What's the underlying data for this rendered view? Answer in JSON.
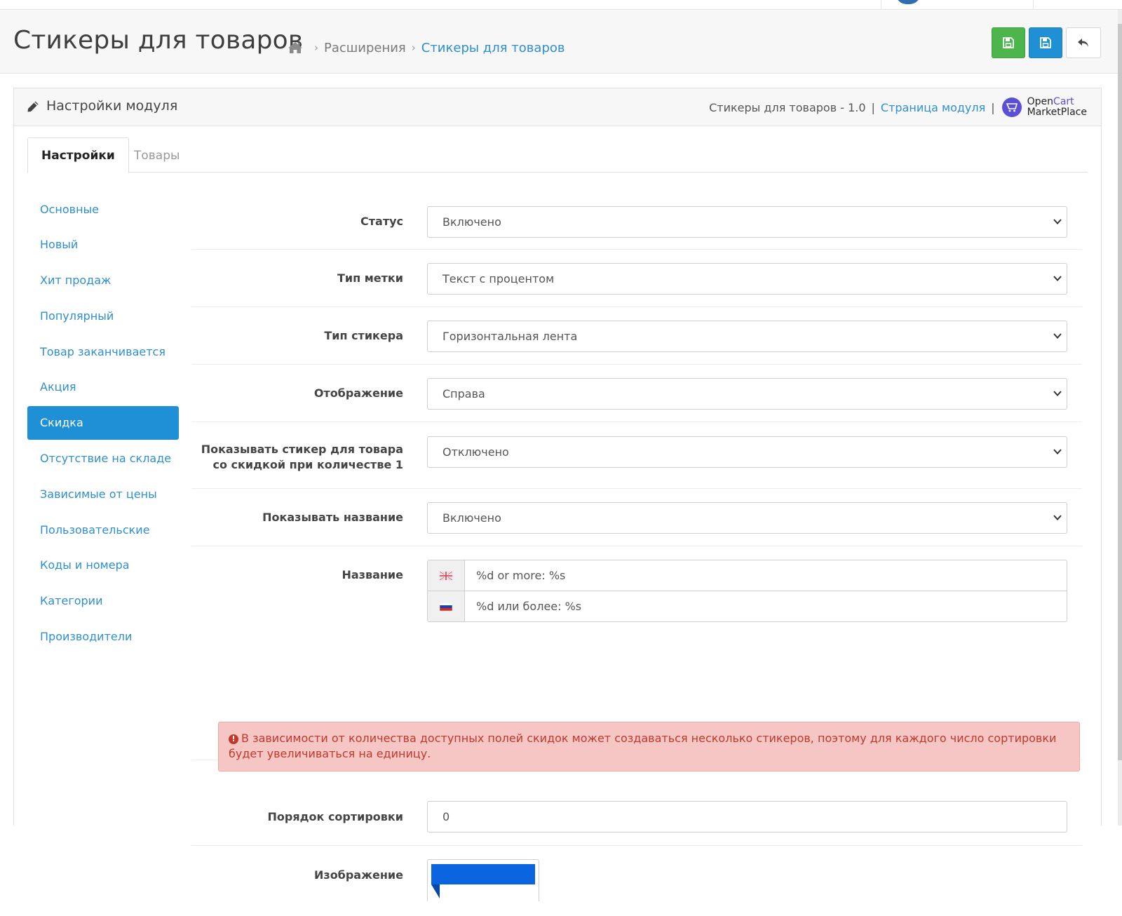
{
  "header": {
    "title": "Стикеры для товаров",
    "breadcrumbs": [
      "Расширения",
      "Стикеры для товаров"
    ],
    "buttons": {
      "save_stay": "save-icon",
      "save": "save-icon",
      "back": "reply-icon"
    }
  },
  "panel": {
    "title": "Настройки модуля",
    "module_version": "Стикеры для товаров - 1.0",
    "module_page_link": "Страница модуля",
    "marketplace": {
      "line1a": "Open",
      "line1b": "Cart",
      "line2": "MarketPlace"
    }
  },
  "tabs": [
    {
      "label": "Настройки",
      "active": true
    },
    {
      "label": "Товары",
      "active": false
    }
  ],
  "sidebar": {
    "items": [
      {
        "label": "Основные"
      },
      {
        "label": "Новый"
      },
      {
        "label": "Хит продаж"
      },
      {
        "label": "Популярный"
      },
      {
        "label": "Товар заканчивается"
      },
      {
        "label": "Акция"
      },
      {
        "label": "Скидка",
        "active": true
      },
      {
        "label": "Отсутствие на складе"
      },
      {
        "label": "Зависимые от цены"
      },
      {
        "label": "Пользовательские"
      },
      {
        "label": "Коды и номера"
      },
      {
        "label": "Категории"
      },
      {
        "label": "Производители"
      }
    ]
  },
  "form": {
    "status": {
      "label": "Статус",
      "value": "Включено"
    },
    "mark_type": {
      "label": "Тип метки",
      "value": "Текст с процентом"
    },
    "sticker_type": {
      "label": "Тип стикера",
      "value": "Горизонтальная лента"
    },
    "display": {
      "label": "Отображение",
      "value": "Справа"
    },
    "show_qty1": {
      "label_line1": "Показывать стикер для товара",
      "label_line2": "со скидкой при количестве 1",
      "value": "Отключено"
    },
    "show_name": {
      "label": "Показывать название",
      "value": "Включено"
    },
    "name": {
      "label": "Название",
      "values": [
        {
          "lang": "en-gb-flag-icon",
          "value": "%d or more:  %s"
        },
        {
          "lang": "ru-flag-icon",
          "value": "%d или более:  %s"
        }
      ]
    },
    "alert": "В зависимости от количества доступных полей скидок может создаваться несколько стикеров, поэтому для каждого число сортировки будет увеличиваться на единицу.",
    "sort_order": {
      "label": "Порядок сортировки",
      "value": "0"
    },
    "image": {
      "label": "Изображение"
    }
  },
  "colors": {
    "accent": "#1f90d6",
    "success": "#4cb64c",
    "link": "#2f8fcd",
    "danger_bg": "#f5c6c4",
    "danger_text": "#c0392b"
  }
}
